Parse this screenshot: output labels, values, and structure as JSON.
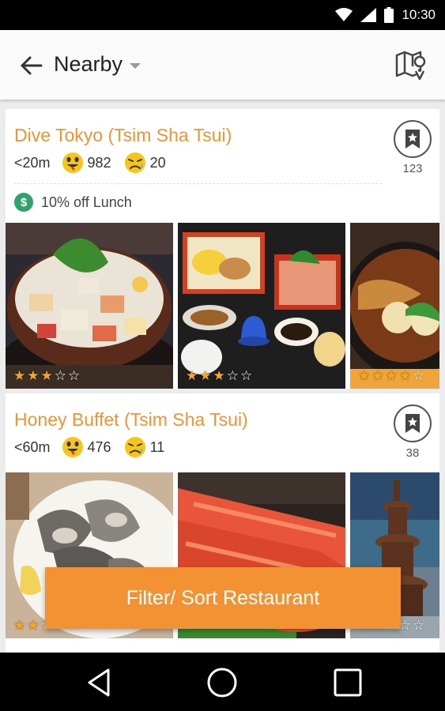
{
  "status_bar": {
    "time": "10:30",
    "icons": [
      "wifi-icon",
      "signal-icon",
      "battery-icon"
    ]
  },
  "app_bar": {
    "back_icon": "arrow-left-icon",
    "title": "Nearby",
    "dropdown_icon": "caret-down-icon",
    "map_icon": "map-icon"
  },
  "restaurants": [
    {
      "name": "Dive Tokyo (Tsim Sha Tsui)",
      "distance": "<20m",
      "likes": "982",
      "dislikes": "20",
      "bookmarks": "123",
      "deal": "10% off Lunch",
      "photos": [
        {
          "rating": 3,
          "desc": "chirashi bowl"
        },
        {
          "rating": 3,
          "desc": "bento set"
        },
        {
          "rating": 4,
          "desc": "sukiyaki"
        }
      ]
    },
    {
      "name": "Honey Buffet (Tsim Sha Tsui)",
      "distance": "<60m",
      "likes": "476",
      "dislikes": "11",
      "bookmarks": "38",
      "photos": [
        {
          "rating": 2,
          "desc": "oysters"
        },
        {
          "rating": 0,
          "desc": "crab legs"
        },
        {
          "rating": 2,
          "desc": "chocolate fountain"
        }
      ]
    }
  ],
  "fab": {
    "label": "Filter/ Sort Restaurant"
  },
  "nav": {
    "back": "nav-back-icon",
    "home": "nav-home-icon",
    "recents": "nav-recents-icon"
  },
  "colors": {
    "accent": "#f39232",
    "deal_green": "#2fa36b",
    "star": "#f5a623"
  }
}
